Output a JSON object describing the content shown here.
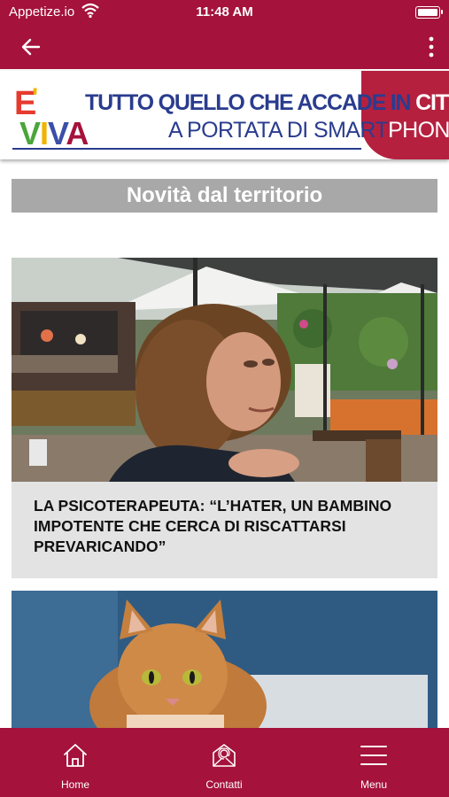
{
  "status_bar": {
    "carrier": "Appetize.io",
    "time": "11:48 AM"
  },
  "banner": {
    "logo_e": "E",
    "logo_apostrophe": "'",
    "logo_viva": [
      "V",
      "I",
      "V",
      "A"
    ],
    "line1_a": "TUTTO QUELLO CHE ACCADE IN",
    "line1_b": "CITTA'",
    "line2_a": "A PORTATA DI SMART",
    "line2_b": "PHONE"
  },
  "section": {
    "title": "Novità dal territorio"
  },
  "articles": [
    {
      "headline": "LA PSICOTERAPEUTA: “L’HATER, UN BAMBINO IMPOTENTE CHE CERCA DI RISCATTARSI PREVARICANDO”"
    }
  ],
  "tabbar": {
    "items": [
      {
        "label": "Home",
        "icon": "home-icon"
      },
      {
        "label": "Contatti",
        "icon": "mail-icon"
      },
      {
        "label": "Menu",
        "icon": "hamburger-icon"
      }
    ]
  },
  "colors": {
    "brand": "#a5123b",
    "section_bg": "#a8a8a8",
    "caption_bg": "#e3e3e3"
  }
}
